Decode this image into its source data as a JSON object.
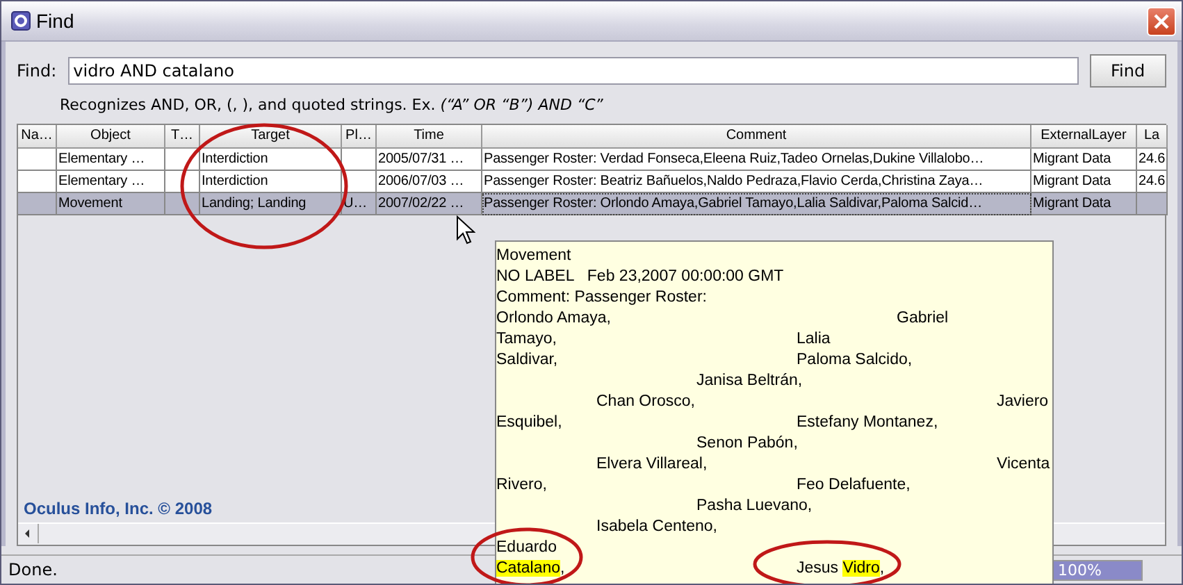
{
  "window": {
    "title": "Find"
  },
  "find": {
    "label": "Find:",
    "value": "vidro AND catalano",
    "button": "Find",
    "hint": "Recognizes AND, OR, (, ), and quoted strings. Ex. ",
    "hint_example": "(“A” OR “B”) AND “C”"
  },
  "table": {
    "columns": [
      "Na…",
      "Object",
      "T…",
      "Target",
      "Pl…",
      "Time",
      "Comment",
      "ExternalLayer",
      "La"
    ],
    "rows": [
      {
        "selected": false,
        "cells": [
          "",
          "Elementary …",
          "",
          "Interdiction",
          "",
          "2005/07/31 …",
          "Passenger Roster: Verdad Fonseca,Eleena Ruiz,Tadeo Ornelas,Dukine Villalobo…",
          "Migrant Data",
          "24.6"
        ]
      },
      {
        "selected": false,
        "cells": [
          "",
          "Elementary …",
          "",
          "Interdiction",
          "",
          "2006/07/03 …",
          "Passenger Roster: Beatriz Bañuelos,Naldo Pedraza,Flavio Cerda,Christina Zaya…",
          "Migrant Data",
          "24.6"
        ]
      },
      {
        "selected": true,
        "cells": [
          "",
          "Movement",
          "",
          "Landing; Landing",
          "U…",
          "2007/02/22 …",
          "Passenger Roster: Orlondo Amaya,Gabriel Tamayo,Lalia Saldivar,Paloma Salcid…",
          "Migrant Data",
          ""
        ]
      }
    ]
  },
  "copyright": "Oculus Info, Inc. © 2008",
  "tooltip": {
    "lines": [
      [
        {
          "text": "Movement",
          "highlight": false
        }
      ],
      [
        {
          "text": "NO LABEL   Feb 23,2007 00:00:00 GMT",
          "highlight": false
        }
      ],
      [
        {
          "text": "Comment: Passenger Roster:",
          "highlight": false
        }
      ],
      [
        {
          "text": "Orlondo Amaya,\t\t\tGabriel",
          "highlight": false
        }
      ],
      [
        {
          "text": "Tamayo,\t\t\tLalia",
          "highlight": false
        }
      ],
      [
        {
          "text": "Saldivar,\t\t\tPaloma Salcido,",
          "highlight": false
        }
      ],
      [
        {
          "text": "\t\tJanisa Beltrán,",
          "highlight": false
        }
      ],
      [
        {
          "text": "\tChan Orosco,\t\t\tJaviero",
          "highlight": false
        }
      ],
      [
        {
          "text": "Esquibel,\t\t\tEstefany Montanez,",
          "highlight": false
        }
      ],
      [
        {
          "text": "\t\tSenon Pabón,",
          "highlight": false
        }
      ],
      [
        {
          "text": "\tElvera Villareal,\t\t\tVicenta",
          "highlight": false
        }
      ],
      [
        {
          "text": "Rivero,\t\t\tFeo Delafuente,",
          "highlight": false
        }
      ],
      [
        {
          "text": "\t\tPasha Luevano,",
          "highlight": false
        }
      ],
      [
        {
          "text": "\tIsabela Centeno,",
          "highlight": false
        }
      ],
      [
        {
          "text": "Eduardo",
          "highlight": false
        }
      ],
      [
        {
          "text": "Catalano",
          "highlight": true
        },
        {
          "text": ",\t\t\tJesus ",
          "highlight": false
        },
        {
          "text": "Vidro",
          "highlight": true
        },
        {
          "text": ",",
          "highlight": false
        }
      ]
    ]
  },
  "status_bar": {
    "text": "Done.",
    "progress": {
      "level": 1,
      "reading": "100%"
    }
  }
}
